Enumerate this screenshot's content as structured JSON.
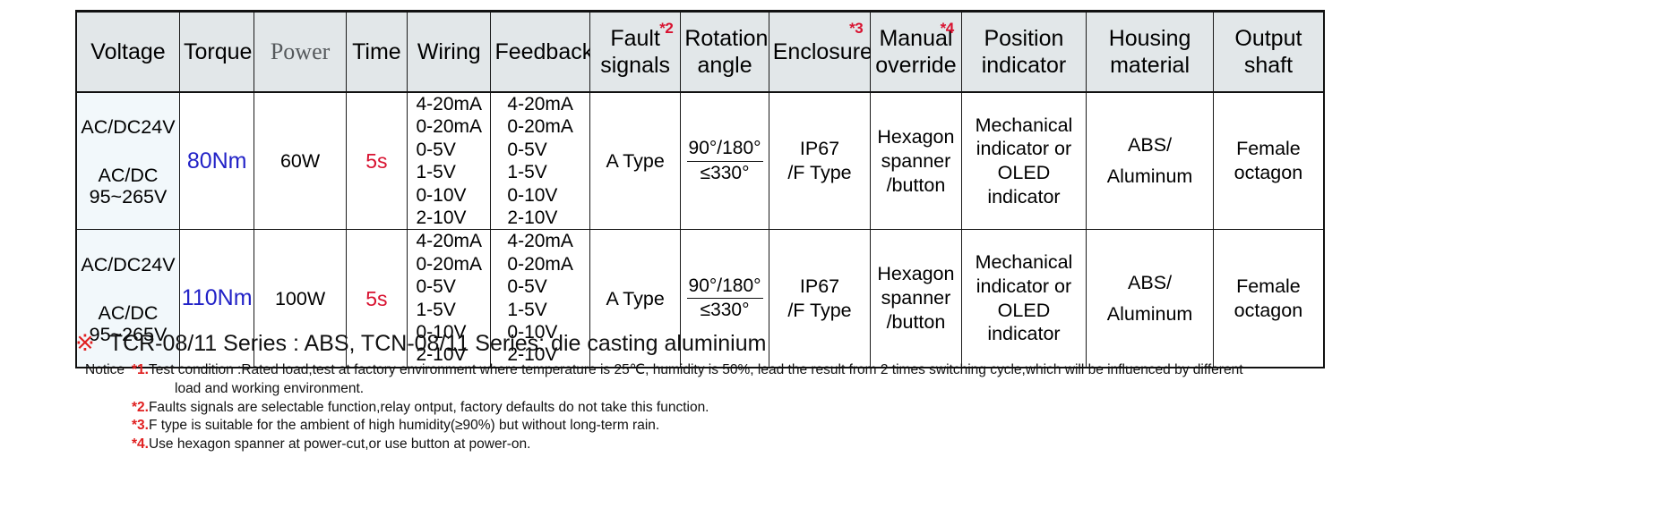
{
  "table": {
    "headers": [
      {
        "label": "Voltage",
        "note": "",
        "style": "plain"
      },
      {
        "label": "Torque",
        "note": "",
        "style": "plain"
      },
      {
        "label": "Power",
        "note": "",
        "style": "serif-gray"
      },
      {
        "label": "Time",
        "note": "",
        "style": "plain"
      },
      {
        "label": "Wiring",
        "note": "",
        "style": "plain"
      },
      {
        "label": "Feedback",
        "note": "",
        "style": "plain"
      },
      {
        "label": "Fault\nsignals",
        "note": "*2",
        "style": "plain"
      },
      {
        "label": "Rotation\nangle",
        "note": "",
        "style": "plain"
      },
      {
        "label": "Enclosure",
        "note": "*3",
        "style": "plain"
      },
      {
        "label": "Manual\noverride",
        "note": "*4",
        "style": "plain"
      },
      {
        "label": "Position\nindicator",
        "note": "",
        "style": "plain"
      },
      {
        "label": "Housing\nmaterial",
        "note": "",
        "style": "plain"
      },
      {
        "label": "Output\nshaft",
        "note": "",
        "style": "plain"
      }
    ],
    "header_flat": {
      "voltage": "Voltage",
      "torque": "Torque",
      "power": "Power",
      "time": "Time",
      "wiring": "Wiring",
      "feedback": "Feedback",
      "fault_signals_l1": "Fault",
      "fault_signals_l2": "signals",
      "fault_signals_note": "*2",
      "rotation_l1": "Rotation",
      "rotation_l2": "angle",
      "enclosure": "Enclosure",
      "enclosure_note": "*3",
      "manual_l1": "Manual",
      "manual_l2": "override",
      "manual_note": "*4",
      "position_l1": "Position",
      "position_l2": "indicator",
      "housing_l1": "Housing",
      "housing_l2": "material",
      "output_l1": "Output",
      "output_l2": "shaft"
    },
    "rows": [
      {
        "voltage_top": "AC/DC24V",
        "voltage_bot_l1": "AC/DC",
        "voltage_bot_l2": "95~265V",
        "torque": "80Nm",
        "power": "60W",
        "time": "5s",
        "wiring": "4-20mA\n0-20mA\n0-5V\n1-5V\n0-10V\n2-10V",
        "wiring_lines": [
          "4-20mA",
          "0-20mA",
          "0-5V",
          "1-5V",
          "0-10V",
          "2-10V"
        ],
        "feedback_lines": [
          "4-20mA",
          "0-20mA",
          "0-5V",
          "1-5V",
          "0-10V",
          "2-10V"
        ],
        "fault_signals": "A Type",
        "rotation_num": "90°/180°",
        "rotation_den": "≤330°",
        "enclosure_l1": "IP67",
        "enclosure_l2": "/F Type",
        "manual_l1": "Hexagon",
        "manual_l2": "spanner",
        "manual_l3": "/button",
        "position_l1": "Mechanical",
        "position_l2": "indicator or",
        "position_l3": "OLED indicator",
        "housing_l1": "ABS/",
        "housing_l2": "Aluminum",
        "output_l1": "Female",
        "output_l2": "octagon"
      },
      {
        "voltage_top": "AC/DC24V",
        "voltage_bot_l1": "AC/DC",
        "voltage_bot_l2": "95~265V",
        "torque": "110Nm",
        "power": "100W",
        "time": "5s",
        "wiring_lines": [
          "4-20mA",
          "0-20mA",
          "0-5V",
          "1-5V",
          "0-10V",
          "2-10V"
        ],
        "feedback_lines": [
          "4-20mA",
          "0-20mA",
          "0-5V",
          "1-5V",
          "0-10V",
          "2-10V"
        ],
        "fault_signals": "A Type",
        "rotation_num": "90°/180°",
        "rotation_den": "≤330°",
        "enclosure_l1": "IP67",
        "enclosure_l2": "/F Type",
        "manual_l1": "Hexagon",
        "manual_l2": "spanner",
        "manual_l3": "/button",
        "position_l1": "Mechanical",
        "position_l2": "indicator or",
        "position_l3": "OLED indicator",
        "housing_l1": "ABS/",
        "housing_l2": "Aluminum",
        "output_l1": "Female",
        "output_l2": "octagon"
      }
    ]
  },
  "series_note": {
    "mark": "※",
    "text": "TCR-08/11 Series : ABS, TCN-08/11 Series: die casting aluminium"
  },
  "notices": {
    "label": "Notice",
    "items": [
      {
        "num": "*1.",
        "text": "Test condition :Rated load,test at factory environment where temperature is 25℃, humidity is 50%, lead the result from 2 times switching cycle,which will be influenced by different",
        "text2": "load and working environment."
      },
      {
        "num": "*2.",
        "text": "Faults signals are selectable function,relay ontput, factory defaults do not take this function."
      },
      {
        "num": "*3.",
        "text": "F type is suitable for the ambient of high humidity(≥90%) but without long-term rain."
      },
      {
        "num": "*4.",
        "text": "Use hexagon spanner at power-cut,or use button at power-on."
      }
    ]
  },
  "colors": {
    "header_bg": "#e2e7e9",
    "voltage_bg": "#f2f8fb",
    "torque_blue": "#2222c7",
    "time_red": "#d81230",
    "note_red": "#e02020",
    "border": "#111111"
  }
}
